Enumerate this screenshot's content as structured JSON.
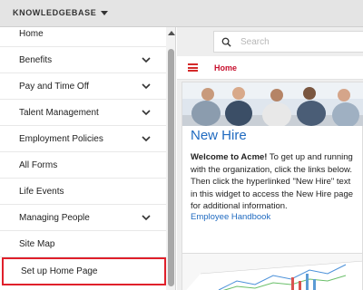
{
  "topbar": {
    "title": "KNOWLEDGEBASE",
    "caret_icon": "caret-down-icon"
  },
  "sidebar": {
    "items": [
      {
        "label": "Home",
        "has_chevron": false
      },
      {
        "label": "Benefits",
        "has_chevron": true
      },
      {
        "label": "Pay and Time Off",
        "has_chevron": true
      },
      {
        "label": "Talent Management",
        "has_chevron": true
      },
      {
        "label": "Employment Policies",
        "has_chevron": true
      },
      {
        "label": "All Forms",
        "has_chevron": false
      },
      {
        "label": "Life Events",
        "has_chevron": false
      },
      {
        "label": "Managing People",
        "has_chevron": true
      },
      {
        "label": "Site Map",
        "has_chevron": false
      },
      {
        "label": "Set up Home Page",
        "has_chevron": false,
        "highlighted": true
      }
    ],
    "highlight_color": "#e0202b"
  },
  "search": {
    "placeholder": "Search",
    "icon": "search-icon"
  },
  "nav": {
    "home_label": "Home",
    "accent_color": "#c8102e"
  },
  "card": {
    "title": "New Hire",
    "body_bold": "Welcome to Acme!",
    "body_text": " To get up and running with the organization, click the links below. Then click the hyperlinked \"New Hire\" text in this widget to access the New Hire page for additional information.",
    "link": "Employee Handbook",
    "link_color": "#1f6ac0"
  }
}
